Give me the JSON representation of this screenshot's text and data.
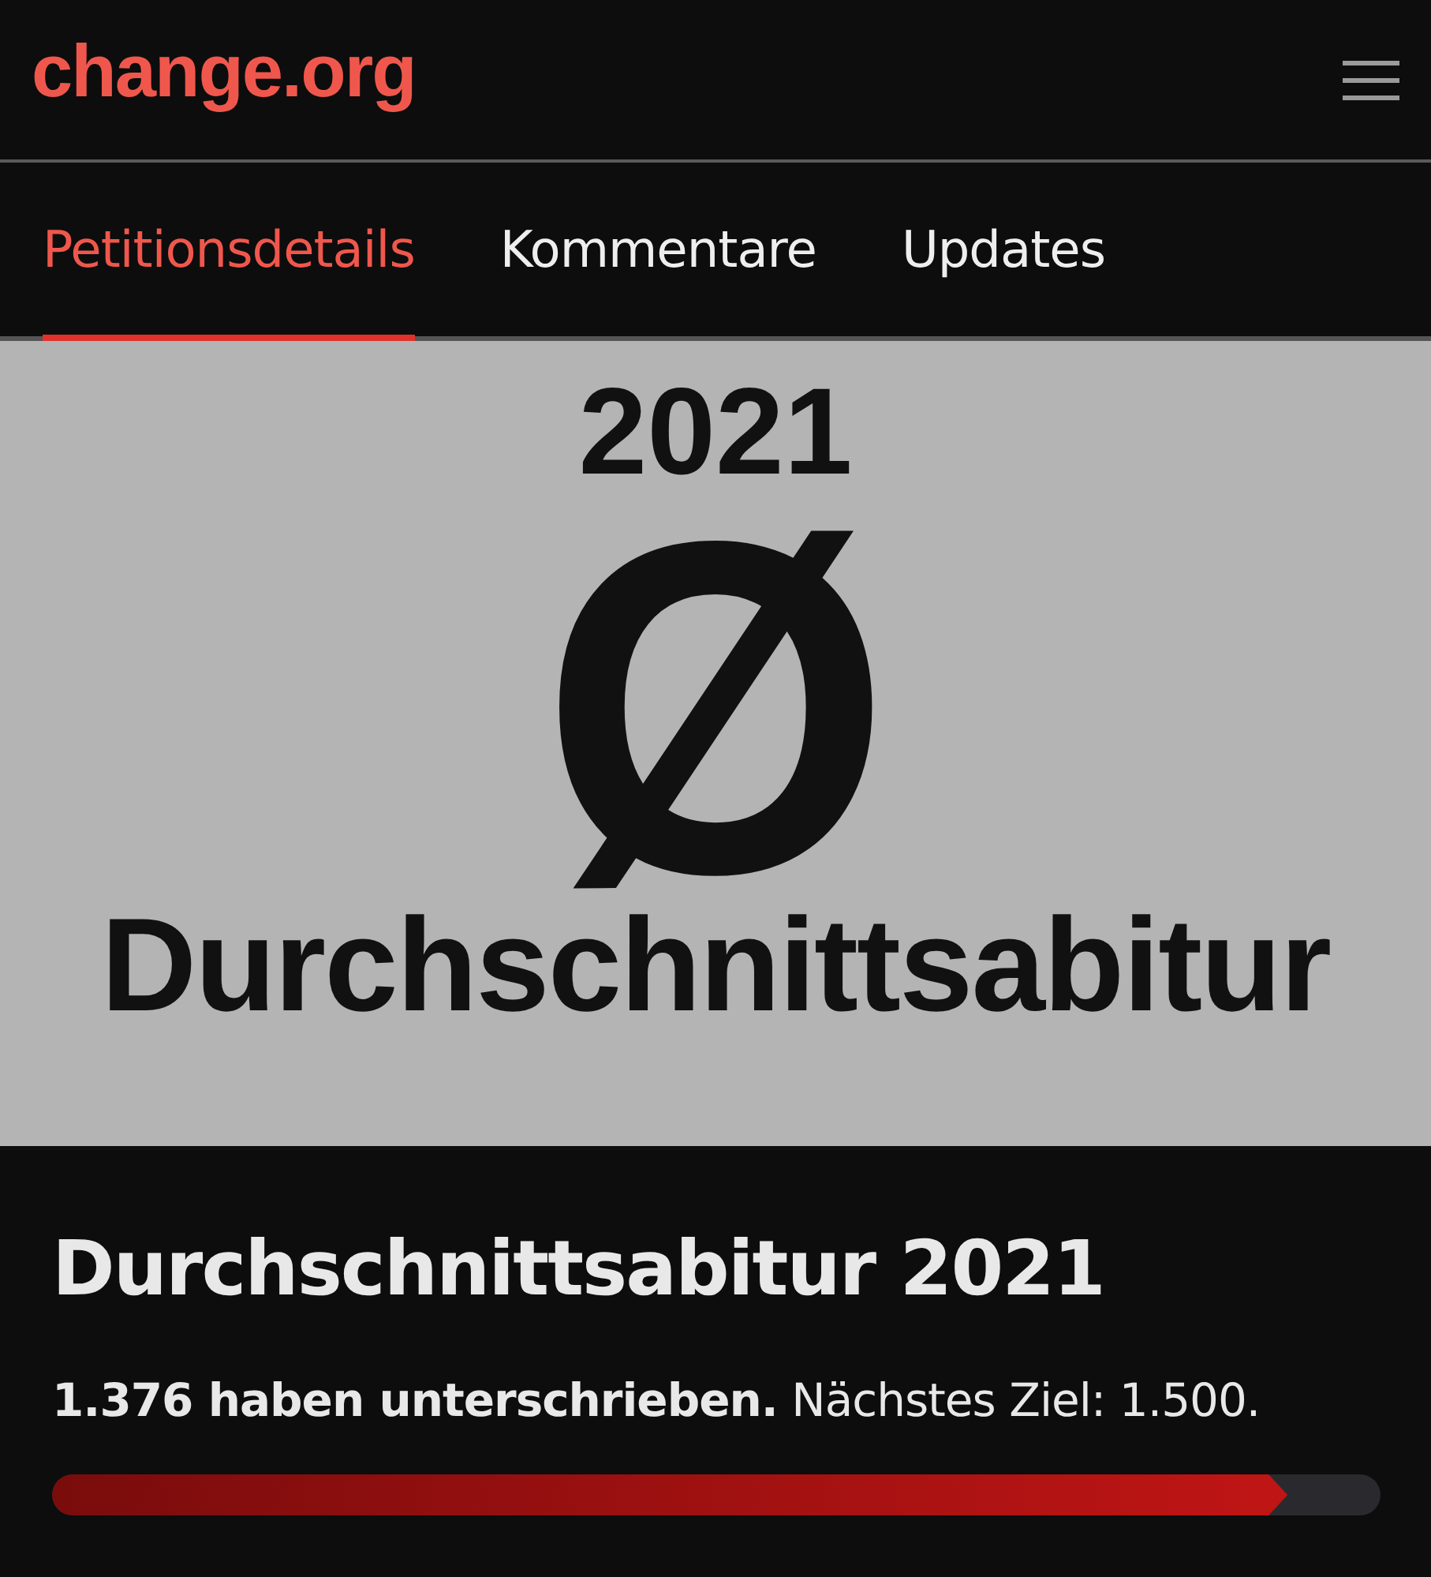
{
  "header": {
    "logo": "change.org"
  },
  "tabs": [
    {
      "label": "Petitionsdetails",
      "selected": true
    },
    {
      "label": "Kommentare",
      "selected": false
    },
    {
      "label": "Updates",
      "selected": false
    }
  ],
  "image": {
    "year": "2021",
    "symbol": "Ø",
    "caption": "Durchschnittsabitur"
  },
  "petition": {
    "title": "Durchschnittsabitur 2021",
    "signed": "1.376 haben unterschrieben.",
    "goal": "Nächstes Ziel: 1.500.",
    "level": 0.93
  }
}
